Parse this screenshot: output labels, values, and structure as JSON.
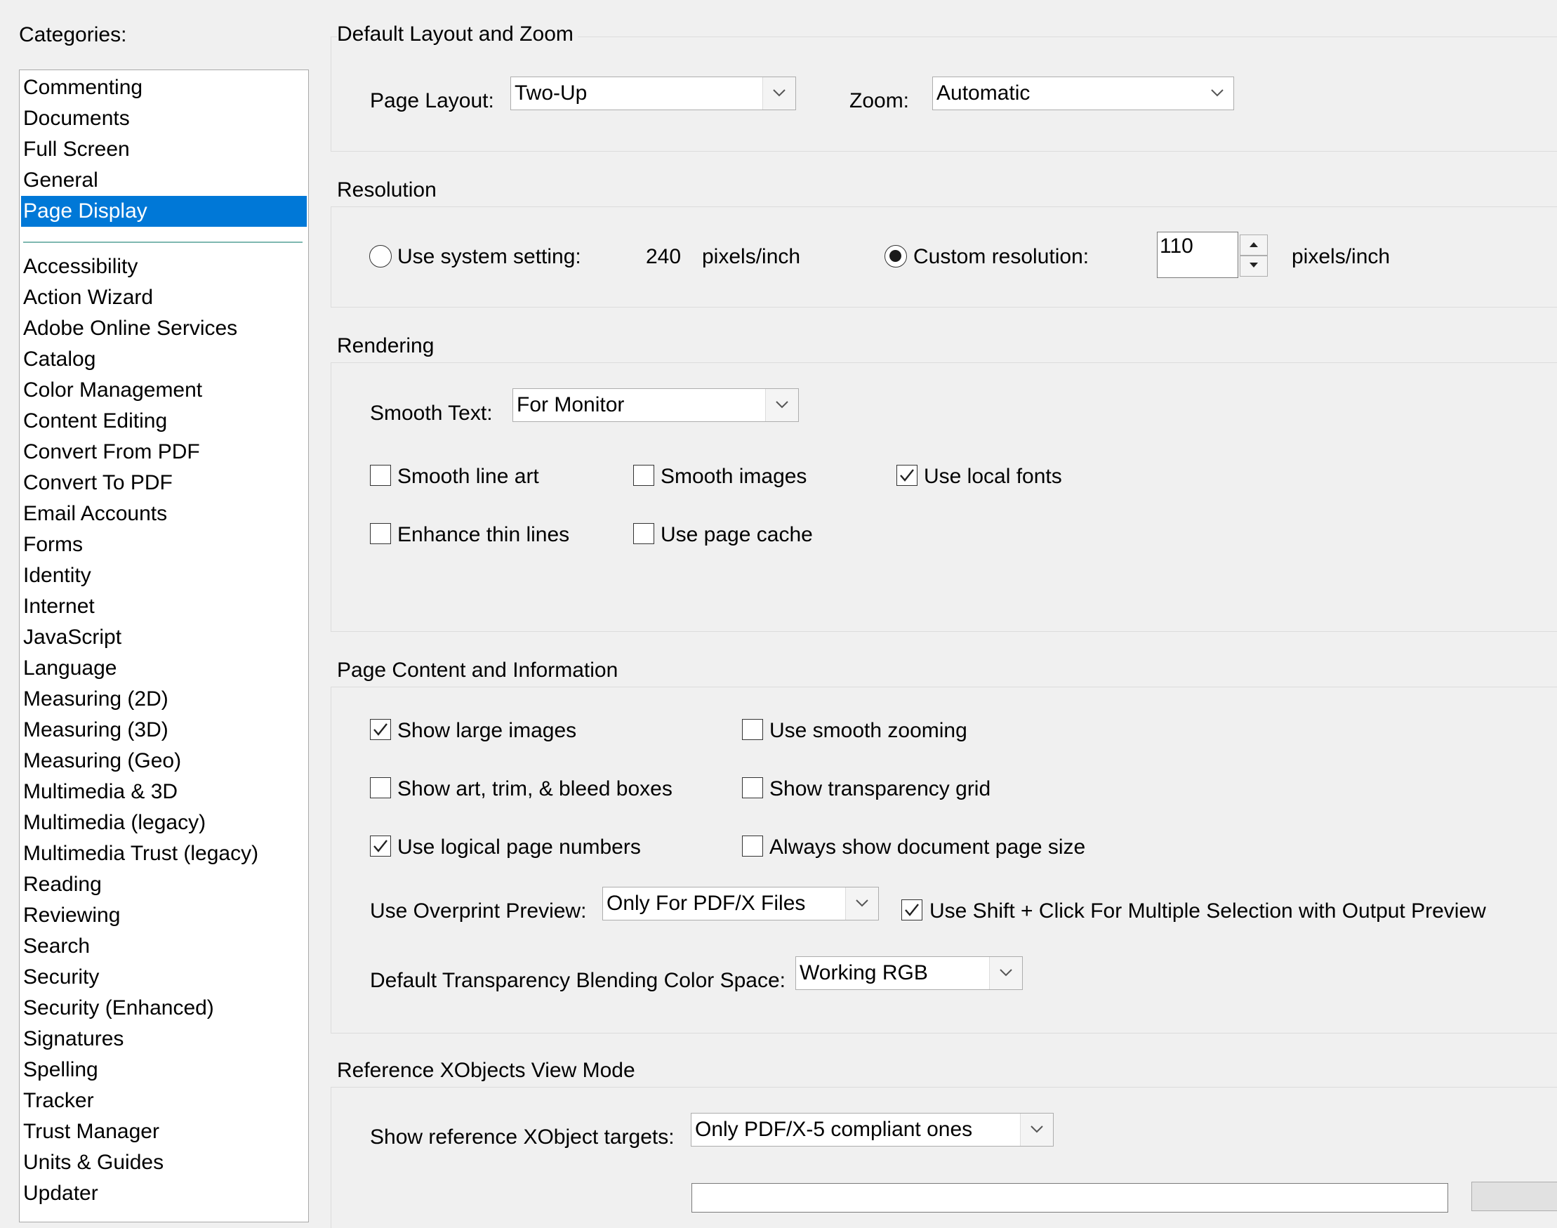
{
  "categories_label": "Categories:",
  "categories": {
    "top": [
      "Commenting",
      "Documents",
      "Full Screen",
      "General",
      "Page Display"
    ],
    "selected": "Page Display",
    "rest": [
      "Accessibility",
      "Action Wizard",
      "Adobe Online Services",
      "Catalog",
      "Color Management",
      "Content Editing",
      "Convert From PDF",
      "Convert To PDF",
      "Email Accounts",
      "Forms",
      "Identity",
      "Internet",
      "JavaScript",
      "Language",
      "Measuring (2D)",
      "Measuring (3D)",
      "Measuring (Geo)",
      "Multimedia & 3D",
      "Multimedia (legacy)",
      "Multimedia Trust (legacy)",
      "Reading",
      "Reviewing",
      "Search",
      "Security",
      "Security (Enhanced)",
      "Signatures",
      "Spelling",
      "Tracker",
      "Trust Manager",
      "Units & Guides",
      "Updater"
    ]
  },
  "layout_zoom": {
    "title": "Default Layout and Zoom",
    "page_layout_label": "Page Layout:",
    "page_layout_value": "Two-Up",
    "zoom_label": "Zoom:",
    "zoom_value": "Automatic"
  },
  "resolution": {
    "title": "Resolution",
    "system_label": "Use system setting:",
    "system_value": "240",
    "system_unit": "pixels/inch",
    "system_selected": false,
    "custom_label": "Custom resolution:",
    "custom_value": "110",
    "custom_unit": "pixels/inch",
    "custom_selected": true
  },
  "rendering": {
    "title": "Rendering",
    "smooth_text_label": "Smooth Text:",
    "smooth_text_value": "For Monitor",
    "smooth_line_art": {
      "label": "Smooth line art",
      "checked": false
    },
    "smooth_images": {
      "label": "Smooth images",
      "checked": false
    },
    "use_local_fonts": {
      "label": "Use local fonts",
      "checked": true
    },
    "enhance_thin_lines": {
      "label": "Enhance thin lines",
      "checked": false
    },
    "use_page_cache": {
      "label": "Use page cache",
      "checked": false
    }
  },
  "page_content": {
    "title": "Page Content and Information",
    "show_large_images": {
      "label": "Show large images",
      "checked": true
    },
    "use_smooth_zooming": {
      "label": "Use smooth zooming",
      "checked": false
    },
    "show_art_trim_bleed": {
      "label": "Show art, trim, & bleed boxes",
      "checked": false
    },
    "show_transparency_grid": {
      "label": "Show transparency grid",
      "checked": false
    },
    "use_logical_page_numbers": {
      "label": "Use logical page numbers",
      "checked": true
    },
    "always_show_page_size": {
      "label": "Always show document page size",
      "checked": false
    },
    "overprint_label": "Use Overprint Preview:",
    "overprint_value": "Only For PDF/X Files",
    "shift_click": {
      "label": "Use Shift + Click For Multiple Selection with Output Preview",
      "checked": true
    },
    "blending_label": "Default Transparency Blending Color Space:",
    "blending_value": "Working RGB"
  },
  "xobjects": {
    "title": "Reference XObjects View Mode",
    "targets_label": "Show reference XObject targets:",
    "targets_value": "Only PDF/X-5 compliant ones"
  },
  "colors": {
    "selection": "#0078d7",
    "background": "#f0f0f0"
  }
}
